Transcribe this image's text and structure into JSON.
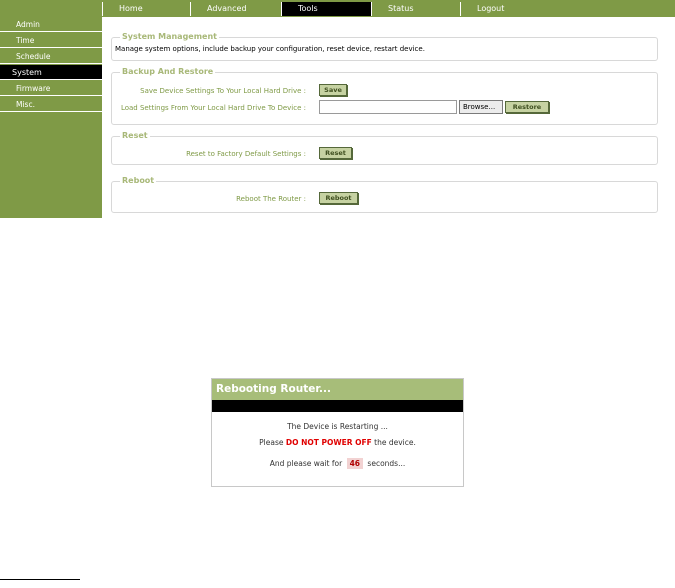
{
  "nav": {
    "tabs": [
      {
        "label": "Home"
      },
      {
        "label": "Advanced"
      },
      {
        "label": "Tools"
      },
      {
        "label": "Status"
      },
      {
        "label": "Logout"
      }
    ],
    "active_tab": "Tools"
  },
  "sidebar": {
    "items": [
      {
        "label": "Admin"
      },
      {
        "label": "Time"
      },
      {
        "label": "Schedule"
      },
      {
        "label": "System"
      },
      {
        "label": "Firmware"
      },
      {
        "label": "Misc."
      }
    ],
    "active_item": "System"
  },
  "system_management": {
    "title": "System Management",
    "description": "Manage system options, include backup your configuration, reset device, restart device."
  },
  "backup_restore": {
    "title": "Backup And Restore",
    "save_label": "Save Device Settings To Your Local Hard Drive :",
    "save_button": "Save",
    "load_label": "Load Settings From Your Local Hard Drive To Device :",
    "file_value": "",
    "browse_button": "Browse...",
    "restore_button": "Restore"
  },
  "reset": {
    "title": "Reset",
    "label": "Reset to Factory Default Settings :",
    "button": "Reset"
  },
  "reboot": {
    "title": "Reboot",
    "label": "Reboot The Router :",
    "button": "Reboot"
  },
  "dialog": {
    "title": "Rebooting Router...",
    "line1": "The Device is Restarting ...",
    "line2_prefix": "Please",
    "line2_warning": "DO NOT POWER OFF",
    "line2_suffix": "the device.",
    "line3_prefix": "And please wait for",
    "countdown": "46",
    "line3_suffix": "seconds..."
  },
  "colors": {
    "brand_green": "#7f9a46",
    "header_green": "#a7bd79",
    "legend_green": "#a8b878",
    "button_fill": "#c6d2a2",
    "warning_red": "#e00000"
  }
}
